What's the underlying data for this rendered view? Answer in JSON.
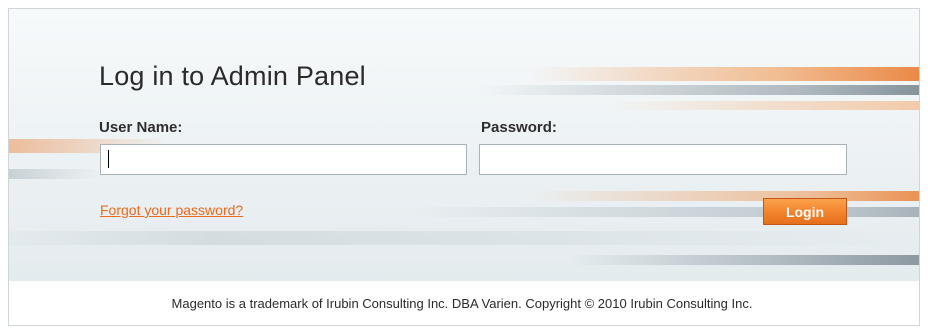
{
  "login_panel": {
    "title": "Log in to Admin Panel",
    "username_label": "User Name:",
    "username_value": "",
    "password_label": "Password:",
    "password_value": "",
    "forgot_password_link": "Forgot your password?",
    "login_button": "Login"
  },
  "footer": {
    "text": "Magento is a trademark of Irubin Consulting Inc. DBA Varien. Copyright © 2010 Irubin Consulting Inc."
  },
  "colors": {
    "accent_orange": "#f3852e",
    "link_orange": "#eb6a1c",
    "streak_gray": "#9fb0b8"
  }
}
